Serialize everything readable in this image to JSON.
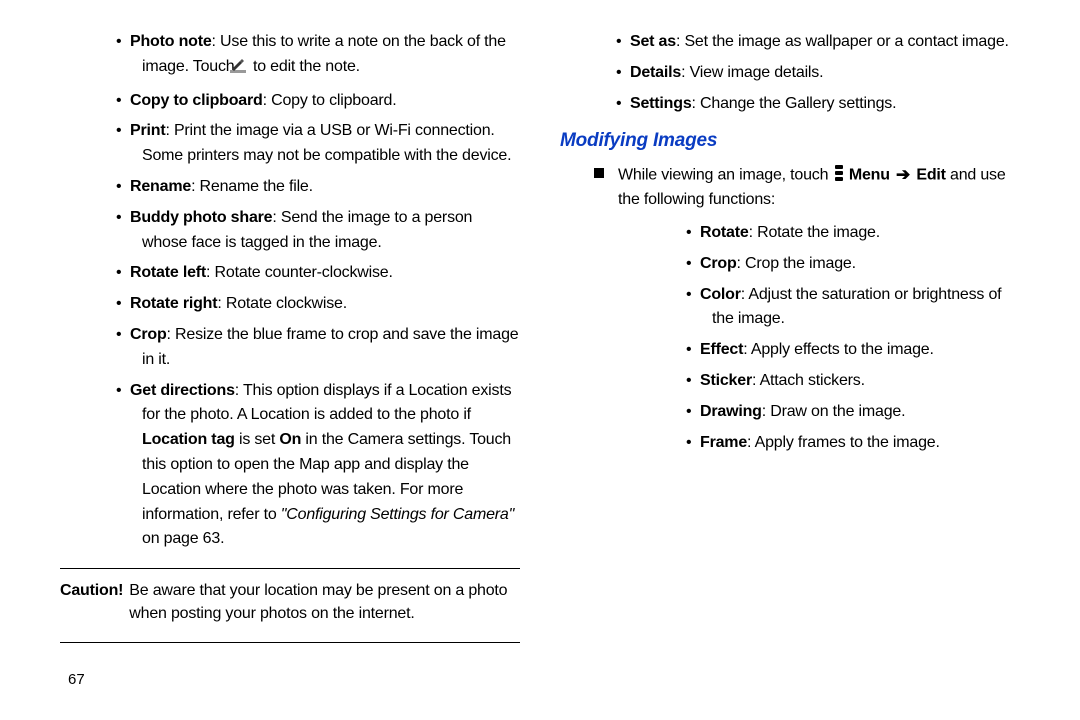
{
  "page_number": "67",
  "left": {
    "items": [
      {
        "term": "Photo note",
        "desc_a": ": Use this to write a note on the back of the image. Touch ",
        "desc_b": " to edit the note."
      },
      {
        "term": "Copy to clipboard",
        "desc": ": Copy to clipboard."
      },
      {
        "term": "Print",
        "desc": ": Print the image via a USB or Wi-Fi connection. Some printers may not be compatible with the device."
      },
      {
        "term": "Rename",
        "desc": ": Rename the file."
      },
      {
        "term": "Buddy photo share",
        "desc": ": Send the image to a person whose face is tagged in the image."
      },
      {
        "term": "Rotate left",
        "desc": ": Rotate counter-clockwise."
      },
      {
        "term": "Rotate right",
        "desc": ": Rotate clockwise."
      },
      {
        "term": "Crop",
        "desc": ": Resize the blue frame to crop and save the image in it."
      },
      {
        "term": "Get directions",
        "desc_a": ": This option displays if a Location exists for the photo. A Location is added to the photo if ",
        "bold_inline": "Location tag",
        "desc_b": " is set ",
        "bold_inline_2": "On",
        "desc_c": " in the Camera settings. Touch this option to open the Map app and display the Location where the photo was taken. For more information, refer to ",
        "italic_ref": "\"Configuring Settings for Camera\"",
        "desc_d": " on page 63."
      }
    ],
    "caution_label": "Caution!",
    "caution_body": "Be aware that your location may be present on a photo when posting your photos on the internet."
  },
  "right": {
    "top_items": [
      {
        "term": "Set as",
        "desc": ": Set the image as wallpaper or a contact image."
      },
      {
        "term": "Details",
        "desc": ": View image details."
      },
      {
        "term": "Settings",
        "desc": ": Change the Gallery settings."
      }
    ],
    "section_head": "Modifying Images",
    "instr_a": "While viewing an image, touch ",
    "instr_menu": "Menu",
    "instr_edit": "Edit",
    "instr_b": " and use the following functions:",
    "sub_items": [
      {
        "term": "Rotate",
        "desc": ": Rotate the image."
      },
      {
        "term": "Crop",
        "desc": ": Crop the image."
      },
      {
        "term": "Color",
        "desc": ": Adjust the saturation or brightness of the image."
      },
      {
        "term": "Effect",
        "desc": ": Apply effects to the image."
      },
      {
        "term": "Sticker",
        "desc": ": Attach stickers."
      },
      {
        "term": "Drawing",
        "desc": ": Draw on the image."
      },
      {
        "term": "Frame",
        "desc": ": Apply frames to the image."
      }
    ]
  }
}
